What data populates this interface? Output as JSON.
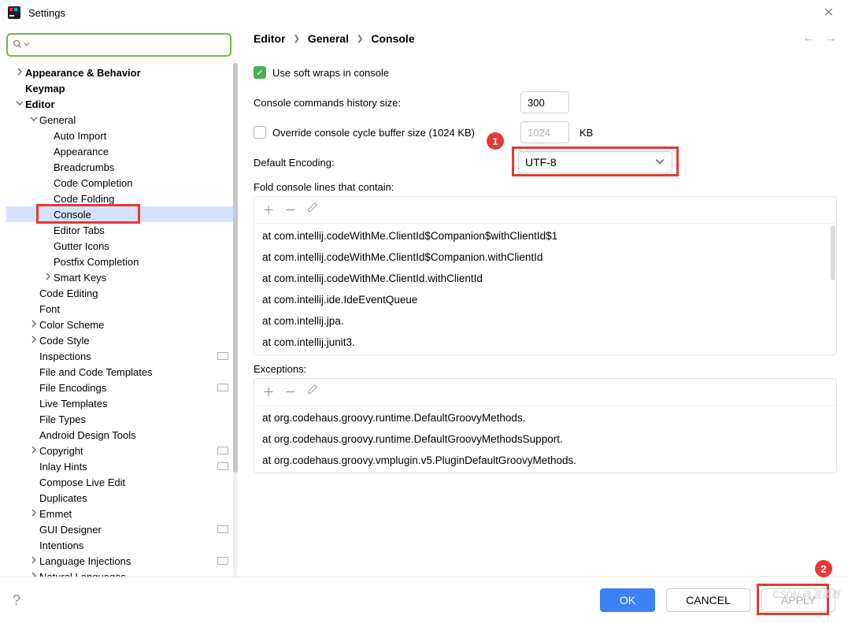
{
  "window": {
    "title": "Settings"
  },
  "search": {
    "placeholder": ""
  },
  "tree": [
    {
      "label": "Appearance & Behavior",
      "level": 0,
      "arrow": "right",
      "bold": true
    },
    {
      "label": "Keymap",
      "level": 0,
      "arrow": "",
      "bold": true
    },
    {
      "label": "Editor",
      "level": 0,
      "arrow": "down",
      "bold": true
    },
    {
      "label": "General",
      "level": 1,
      "arrow": "down"
    },
    {
      "label": "Auto Import",
      "level": 2,
      "arrow": ""
    },
    {
      "label": "Appearance",
      "level": 2,
      "arrow": ""
    },
    {
      "label": "Breadcrumbs",
      "level": 2,
      "arrow": ""
    },
    {
      "label": "Code Completion",
      "level": 2,
      "arrow": ""
    },
    {
      "label": "Code Folding",
      "level": 2,
      "arrow": ""
    },
    {
      "label": "Console",
      "level": 2,
      "arrow": "",
      "selected": true,
      "boxed": true
    },
    {
      "label": "Editor Tabs",
      "level": 2,
      "arrow": ""
    },
    {
      "label": "Gutter Icons",
      "level": 2,
      "arrow": ""
    },
    {
      "label": "Postfix Completion",
      "level": 2,
      "arrow": ""
    },
    {
      "label": "Smart Keys",
      "level": 2,
      "arrow": "right"
    },
    {
      "label": "Code Editing",
      "level": 1,
      "arrow": ""
    },
    {
      "label": "Font",
      "level": 1,
      "arrow": ""
    },
    {
      "label": "Color Scheme",
      "level": 1,
      "arrow": "right"
    },
    {
      "label": "Code Style",
      "level": 1,
      "arrow": "right"
    },
    {
      "label": "Inspections",
      "level": 1,
      "arrow": "",
      "cfg": true
    },
    {
      "label": "File and Code Templates",
      "level": 1,
      "arrow": ""
    },
    {
      "label": "File Encodings",
      "level": 1,
      "arrow": "",
      "cfg": true
    },
    {
      "label": "Live Templates",
      "level": 1,
      "arrow": ""
    },
    {
      "label": "File Types",
      "level": 1,
      "arrow": ""
    },
    {
      "label": "Android Design Tools",
      "level": 1,
      "arrow": ""
    },
    {
      "label": "Copyright",
      "level": 1,
      "arrow": "right",
      "cfg": true
    },
    {
      "label": "Inlay Hints",
      "level": 1,
      "arrow": "",
      "cfg": true
    },
    {
      "label": "Compose Live Edit",
      "level": 1,
      "arrow": ""
    },
    {
      "label": "Duplicates",
      "level": 1,
      "arrow": ""
    },
    {
      "label": "Emmet",
      "level": 1,
      "arrow": "right"
    },
    {
      "label": "GUI Designer",
      "level": 1,
      "arrow": "",
      "cfg": true
    },
    {
      "label": "Intentions",
      "level": 1,
      "arrow": ""
    },
    {
      "label": "Language Injections",
      "level": 1,
      "arrow": "right",
      "cfg": true
    },
    {
      "label": "Natural Languages",
      "level": 1,
      "arrow": "right"
    }
  ],
  "crumbs": [
    "Editor",
    "General",
    "Console"
  ],
  "form": {
    "soft_wraps_label": "Use soft wraps in console",
    "history_label": "Console commands history size:",
    "history_value": "300",
    "override_label": "Override console cycle buffer size (1024 KB)",
    "override_value": "1024",
    "override_unit": "KB",
    "encoding_label": "Default Encoding:",
    "encoding_value": "UTF-8",
    "fold_label": "Fold console lines that contain:",
    "exceptions_label": "Exceptions:"
  },
  "fold_items": [
    "at com.intellij.codeWithMe.ClientId$Companion$withClientId$1",
    "at com.intellij.codeWithMe.ClientId$Companion.withClientId",
    "at com.intellij.codeWithMe.ClientId.withClientId",
    "at com.intellij.ide.IdeEventQueue",
    "at com.intellij.jpa.",
    "at com.intellij.junit3."
  ],
  "exception_items": [
    "at org.codehaus.groovy.runtime.DefaultGroovyMethods.",
    "at org.codehaus.groovy.runtime.DefaultGroovyMethodsSupport.",
    "at org.codehaus.groovy.vmplugin.v5.PluginDefaultGroovyMethods."
  ],
  "callouts": {
    "c1": "1",
    "c2": "2"
  },
  "buttons": {
    "ok": "OK",
    "cancel": "CANCEL",
    "apply": "APPLY"
  },
  "watermark": "CSDN @温柔哥"
}
